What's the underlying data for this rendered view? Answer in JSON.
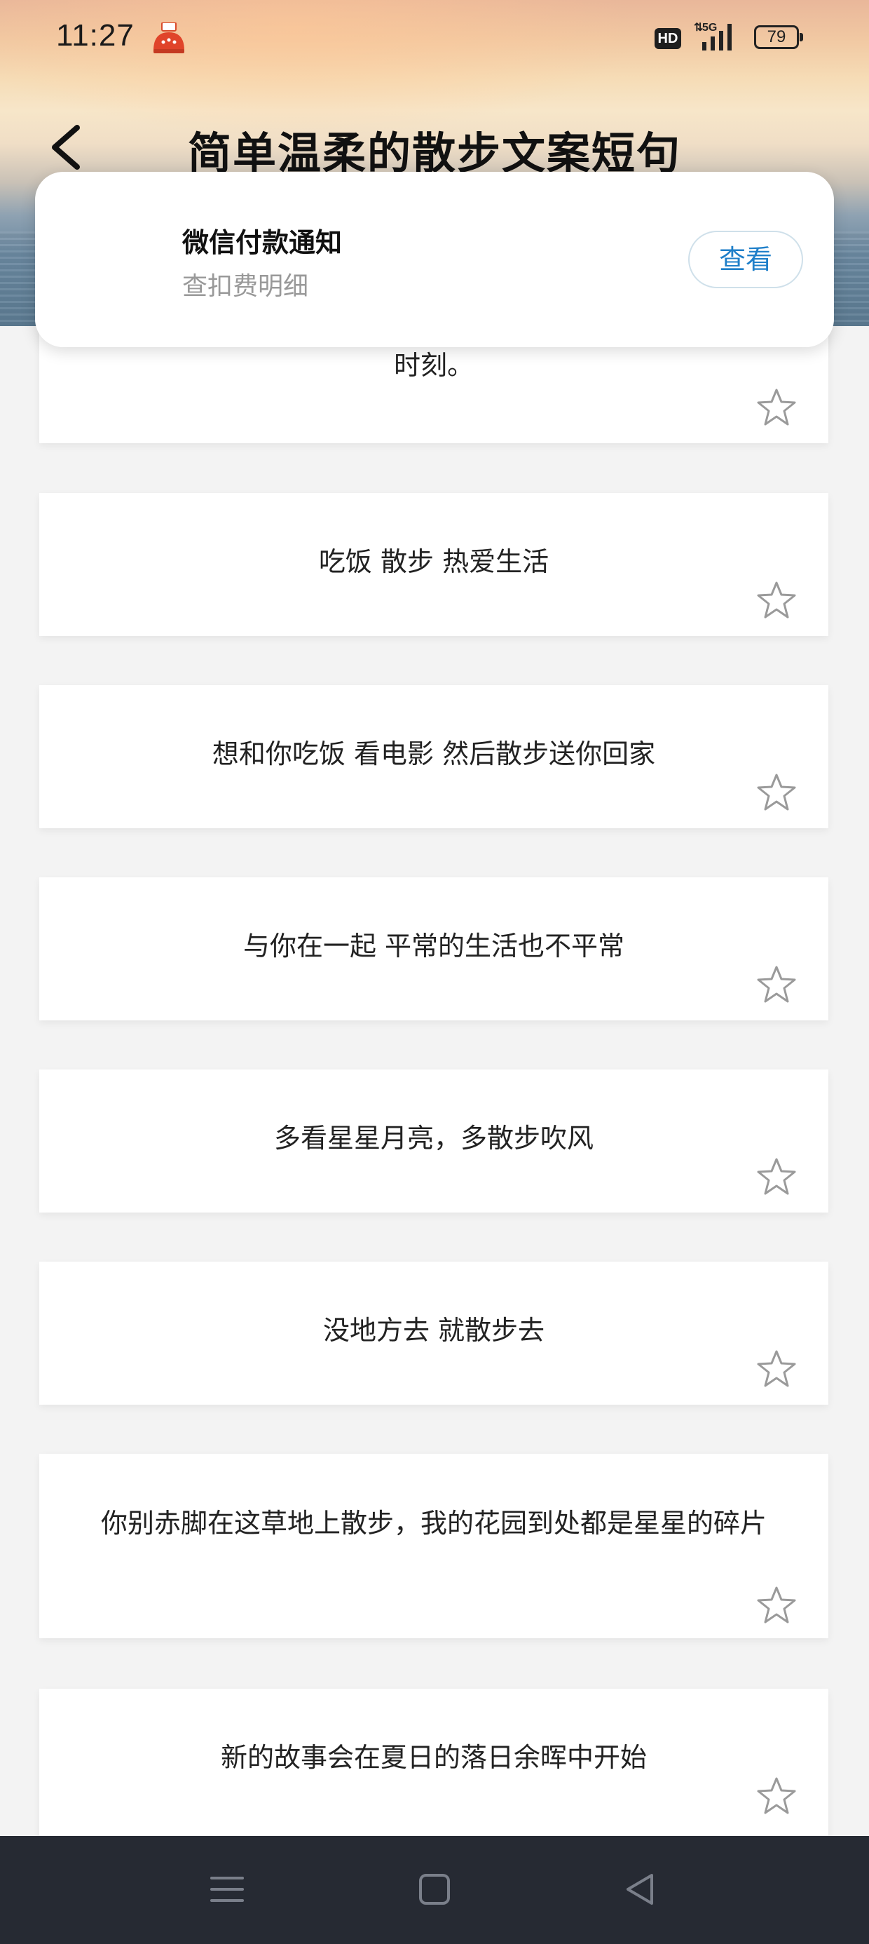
{
  "status_bar": {
    "time": "11:27",
    "hd_label": "HD",
    "network_label": "5G",
    "battery_level": "79"
  },
  "header": {
    "title": "简单温柔的散步文案短句"
  },
  "notification": {
    "title": "微信付款通知",
    "subtitle": "查扣费明细",
    "action_label": "查看"
  },
  "cards": [
    {
      "text": "时刻。",
      "favorited": false
    },
    {
      "text": "吃饭 散步 热爱生活",
      "favorited": false
    },
    {
      "text": "想和你吃饭 看电影 然后散步送你回家",
      "favorited": false
    },
    {
      "text": "与你在一起 平常的生活也不平常",
      "favorited": false
    },
    {
      "text": "多看星星月亮，多散步吹风",
      "favorited": false
    },
    {
      "text": "没地方去 就散步去",
      "favorited": false
    },
    {
      "text": "你别赤脚在这草地上散步，我的花园到处都是星星的碎片",
      "favorited": false
    },
    {
      "text": "新的故事会在夏日的落日余晖中开始",
      "favorited": false
    }
  ],
  "icons": {
    "back": "chevron-left-icon",
    "star": "star-outline-icon",
    "nav_menu": "menu-icon",
    "nav_home": "square-icon",
    "nav_back": "triangle-back-icon"
  },
  "colors": {
    "accent_blue": "#1f7fc9",
    "nav_bar": "#262a33",
    "star_outline": "#9a9a9a"
  }
}
